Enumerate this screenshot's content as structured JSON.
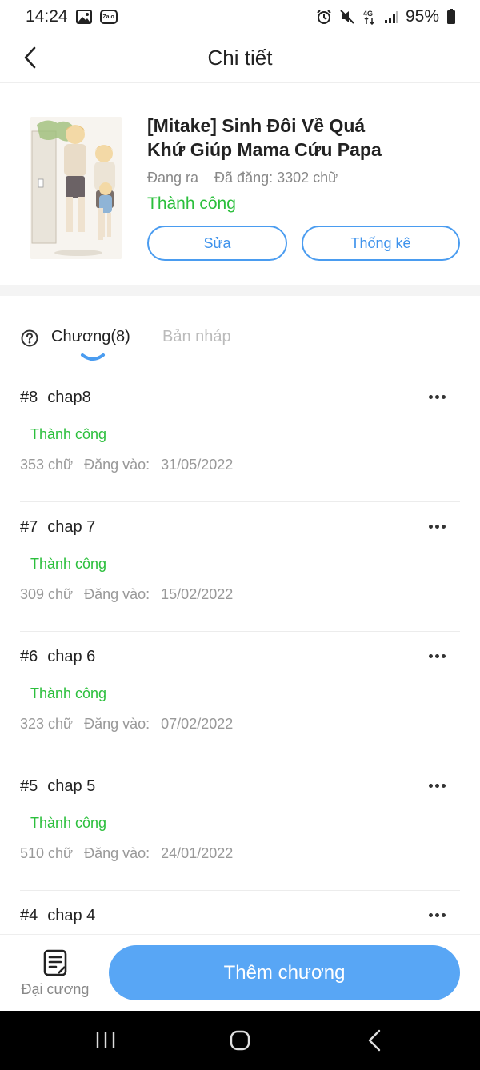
{
  "status_bar": {
    "time": "14:24",
    "battery": "95%"
  },
  "header": {
    "title": "Chi tiết"
  },
  "book": {
    "title": "[Mitake] Sinh Đôi Về Quá Khứ Giúp Mama Cứu Papa",
    "state": "Đang ra",
    "posted": "Đã đăng: 3302 chữ",
    "status": "Thành công",
    "edit_label": "Sửa",
    "stats_label": "Thống kê"
  },
  "tabs": {
    "chapters": "Chương(8)",
    "drafts": "Bản nháp"
  },
  "chapters": [
    {
      "num": "#8",
      "name": "chap8",
      "status": "Thành công",
      "words": "353 chữ",
      "date_label": "Đăng vào:",
      "date": "31/05/2022"
    },
    {
      "num": "#7",
      "name": "chap 7",
      "status": "Thành công",
      "words": "309 chữ",
      "date_label": "Đăng vào:",
      "date": "15/02/2022"
    },
    {
      "num": "#6",
      "name": "chap 6",
      "status": "Thành công",
      "words": "323 chữ",
      "date_label": "Đăng vào:",
      "date": "07/02/2022"
    },
    {
      "num": "#5",
      "name": "chap 5",
      "status": "Thành công",
      "words": "510 chữ",
      "date_label": "Đăng vào:",
      "date": "24/01/2022"
    },
    {
      "num": "#4",
      "name": "chap 4",
      "status": "",
      "words": "",
      "date_label": "",
      "date": ""
    }
  ],
  "bottom": {
    "outline_label": "Đại cương",
    "add_label": "Thêm chương"
  },
  "colors": {
    "accent": "#58a6f5",
    "success": "#2bbf3c",
    "outline_border": "#4a9cf0"
  }
}
